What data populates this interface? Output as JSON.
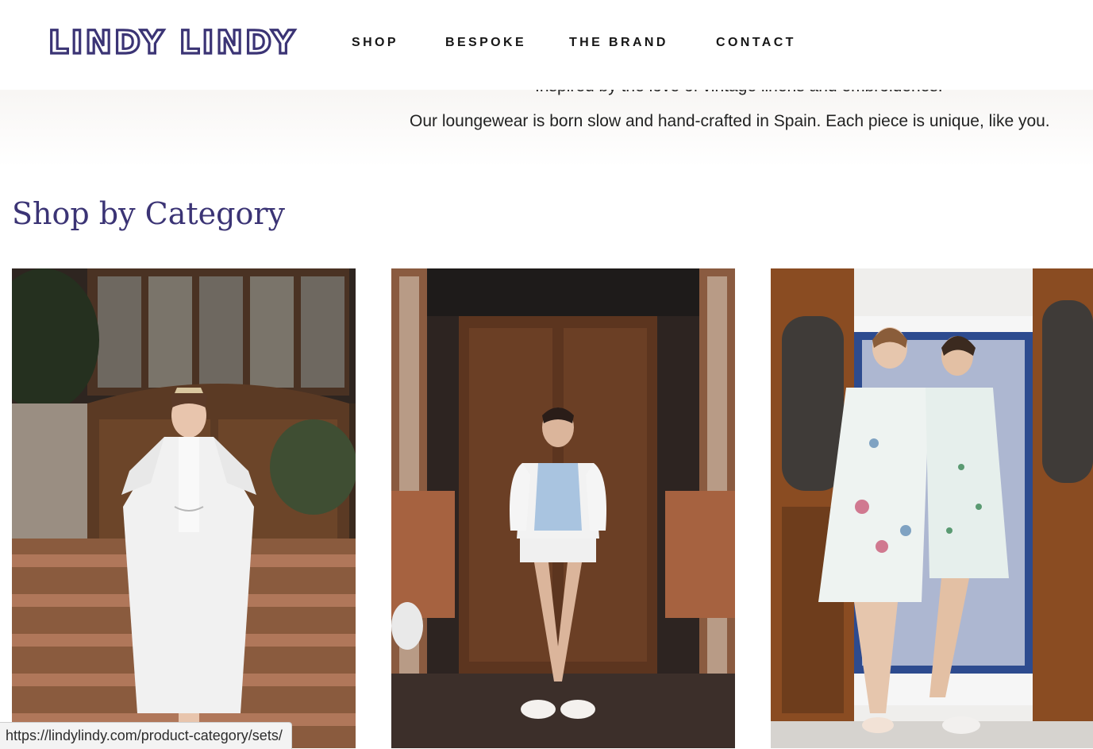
{
  "brand": {
    "logo_text": "LINDY LINDY",
    "color": "#3b3475"
  },
  "nav": {
    "items": [
      {
        "label": "SHOP"
      },
      {
        "label": "BESPOKE"
      },
      {
        "label": "THE BRAND"
      },
      {
        "label": "CONTACT"
      }
    ]
  },
  "intro": {
    "line1": "Inspired by the love of vintage linens and embroideries.",
    "line2": "Our loungewear is born slow and hand-crafted in Spain. Each piece is unique, like you."
  },
  "section": {
    "title": "Shop by Category"
  },
  "categories": [
    {
      "image_icon": "woman-white-embroidered-robe-photo"
    },
    {
      "image_icon": "woman-blue-white-blouse-photo"
    },
    {
      "image_icon": "two-women-floral-robes-photo"
    }
  ],
  "status_bar": {
    "url": "https://lindylindy.com/product-category/sets/"
  }
}
